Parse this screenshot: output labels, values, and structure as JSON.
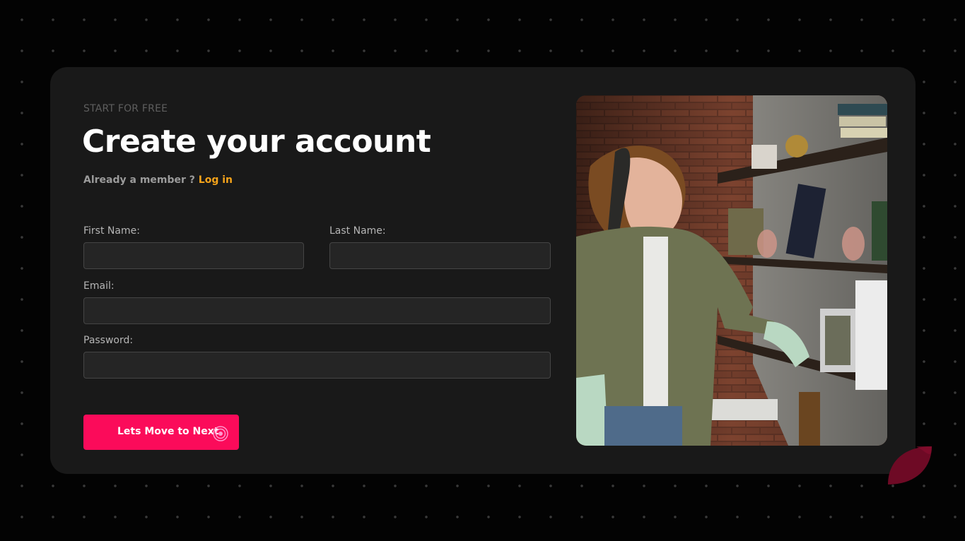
{
  "header": {
    "eyebrow": "START FOR FREE",
    "title": "Create your account",
    "member_prompt": "Already a member ?",
    "login_link": "Log in"
  },
  "form": {
    "first_name_label": "First Name:",
    "first_name_value": "",
    "last_name_label": "Last Name:",
    "last_name_value": "",
    "email_label": "Email:",
    "email_value": "",
    "password_label": "Password:",
    "password_value": ""
  },
  "submit": {
    "label": "Lets Move to Next",
    "icon": "ripple-icon"
  },
  "photo": {
    "icon": "woman-arranging-shelf-photo"
  },
  "colors": {
    "accent_button": "#fb0b5a",
    "link": "#f5a31a",
    "card": "#191919",
    "background": "#030303"
  }
}
